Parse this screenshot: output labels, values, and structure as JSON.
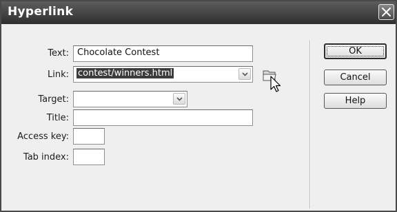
{
  "dialog": {
    "title": "Hyperlink",
    "close_icon": "close-icon"
  },
  "form": {
    "text_label": "Text:",
    "text_value": "Chocolate Contest",
    "link_label": "Link:",
    "link_value": "contest/winners.html",
    "target_label": "Target:",
    "target_value": "",
    "title_label": "Title:",
    "title_value": "",
    "access_key_label": "Access key:",
    "access_key_value": "",
    "tab_index_label": "Tab index:",
    "tab_index_value": "",
    "browse_icon": "folder-icon"
  },
  "buttons": {
    "ok": "OK",
    "cancel": "Cancel",
    "help": "Help"
  }
}
